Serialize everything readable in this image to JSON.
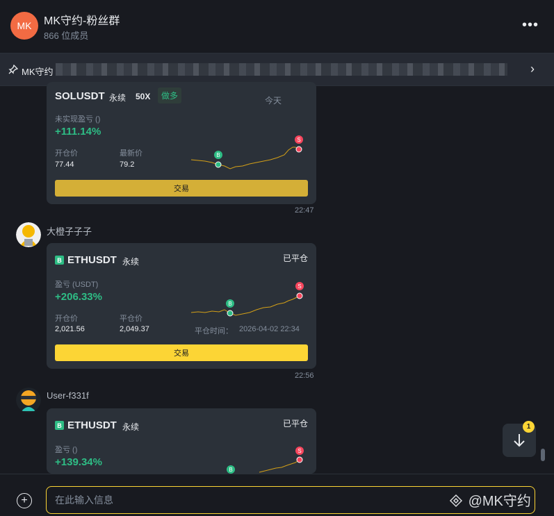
{
  "header": {
    "avatar_text": "MK",
    "title": "MK守约-粉丝群",
    "members": "866 位成员",
    "more": "•••"
  },
  "pinned": {
    "icon": "pin-icon",
    "text": "MK守约",
    "arrow": "›"
  },
  "messages": [
    {
      "time": "22:47",
      "card": {
        "pair": "SOLUSDT",
        "perp": "永续",
        "leverage": "50X",
        "side": "做多",
        "date": "今天",
        "pnl_label": "未实现盈亏 ()",
        "pnl_value": "+111.14%",
        "open_label": "开仓价",
        "open_value": "77.44",
        "last_label": "最新价",
        "last_value": "79.2",
        "button": "交易",
        "button_color": "#d4af37"
      }
    },
    {
      "user": "大橙子子子",
      "time": "22:56",
      "card": {
        "badge": "B",
        "pair": "ETHUSDT",
        "perp": "永续",
        "status": "已平仓",
        "pnl_label": "盈亏 (USDT)",
        "pnl_value": "+206.33%",
        "open_label": "开仓价",
        "open_value": "2,021.56",
        "close_label": "平仓价",
        "close_value": "2,049.37",
        "close_time_label": "平仓时间：",
        "close_time": "2026-04-02 22:34",
        "button": "交易",
        "button_color": "#fcd535"
      }
    },
    {
      "user": "User-f331f",
      "card": {
        "badge": "B",
        "pair": "ETHUSDT",
        "perp": "永续",
        "status": "已平仓",
        "pnl_label": "盈亏 ()",
        "pnl_value": "+139.34%"
      }
    }
  ],
  "scroll": {
    "badge": "1",
    "icon": "arrow-down-icon"
  },
  "footer": {
    "placeholder": "在此输入信息",
    "plus": "+",
    "watermark": "@MK守约"
  },
  "colors": {
    "accent": "#fcd535",
    "profit": "#2ebd85",
    "loss": "#f6465d"
  }
}
